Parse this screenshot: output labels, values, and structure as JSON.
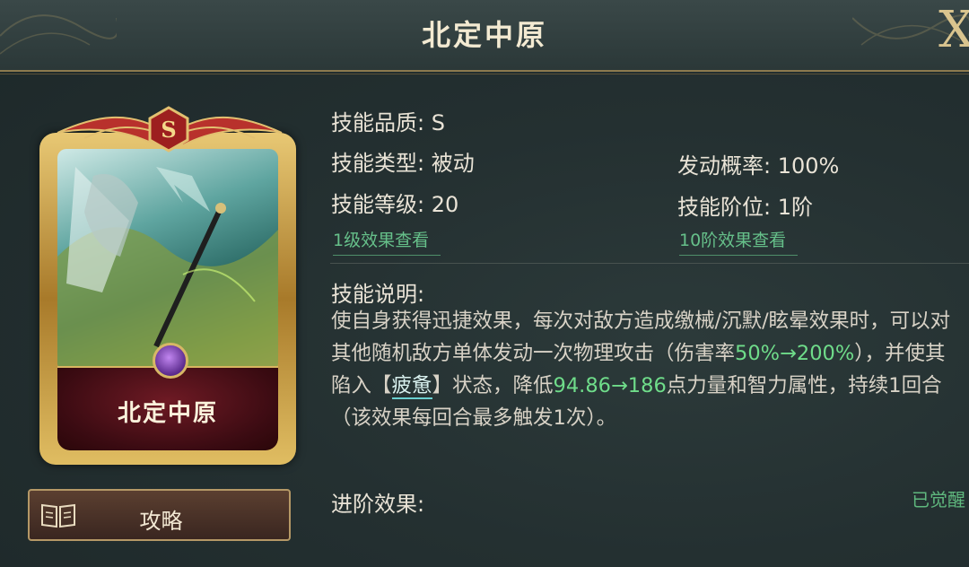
{
  "header": {
    "title": "北定中原",
    "close_label": "X"
  },
  "card": {
    "name": "北定中原",
    "grade_badge": "S",
    "colors": {
      "frame": "#d7b766",
      "name_panel": "#4a0e17",
      "gem": "#8a4bc4"
    }
  },
  "guide_button": {
    "label": "攻略",
    "icon": "book-icon"
  },
  "skill": {
    "quality": "技能品质: S",
    "type": "技能类型: 被动",
    "trigger_rate": "发动概率: 100%",
    "level": "技能等级: 20",
    "tier": "技能阶位: 1阶",
    "level1_link": "1级效果查看",
    "tier10_link": "10阶效果查看",
    "desc_title": "技能说明:",
    "desc": {
      "p1": "使自身获得迅捷效果，每次对敌方造成缴械/沉默/眩晕效果时，可以对其他随机敌方单体发动一次物理攻击（伤害率",
      "dmg_range": "50%→200%",
      "p2": "），并使其陷入【",
      "status": "疲惫",
      "p3": "】状态，降低",
      "reduce_range": "94.86→186",
      "p4": "点力量和智力属性，持续1回合（该效果每回合最多触发1次）。"
    },
    "advance_title": "进阶效果:",
    "awakened": "已觉醒"
  },
  "colors": {
    "accent_green": "#6fdc8a",
    "gold": "#d7b766",
    "text": "#e9e3d6"
  }
}
